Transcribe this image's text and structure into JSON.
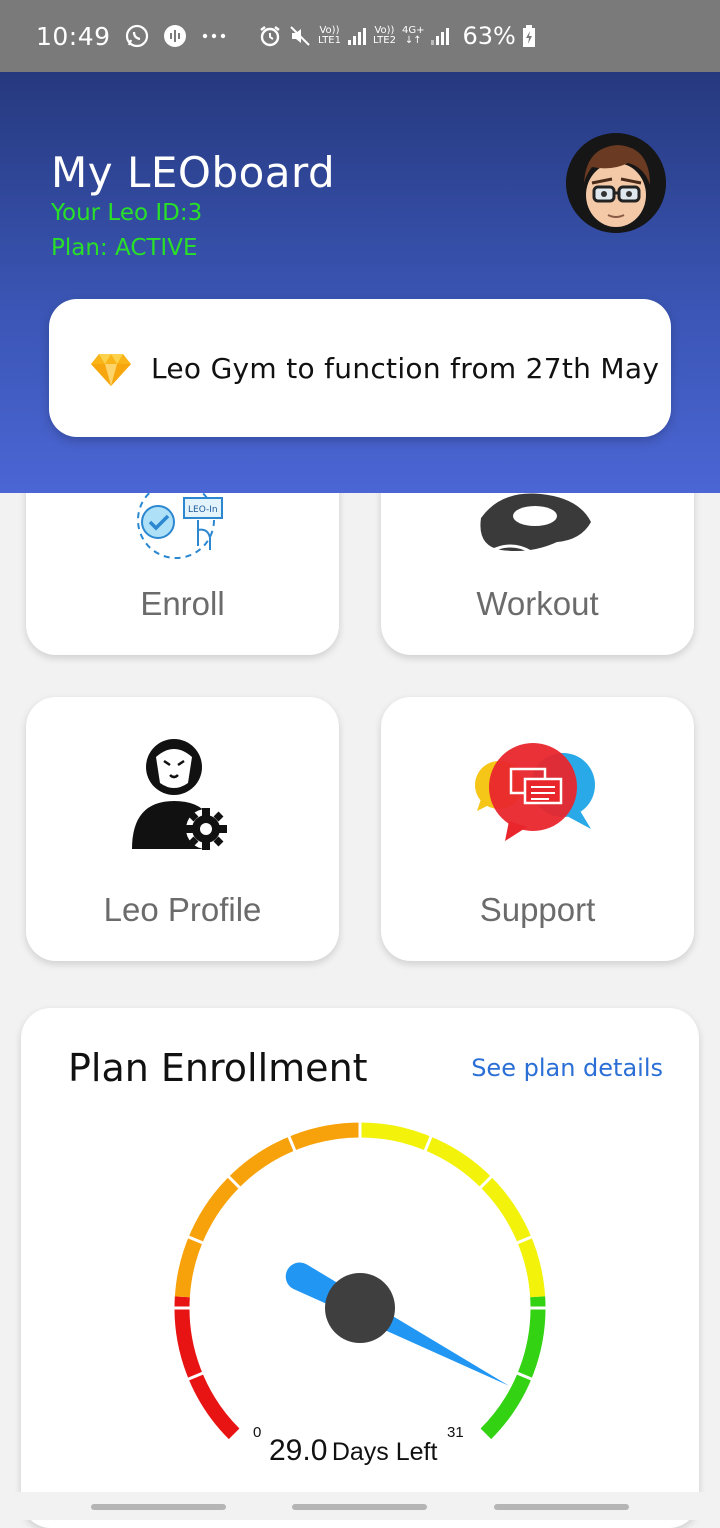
{
  "status_bar": {
    "time": "10:49",
    "icons_left": [
      "whatsapp-icon",
      "voice-icon",
      "more-icon"
    ],
    "sim1_label_top": "Vo))",
    "sim1_label_bottom": "LTE1",
    "sim2_label_top": "Vo))",
    "sim2_label_bottom": "LTE2",
    "network_type": "4G+",
    "battery_percent": "63%"
  },
  "header": {
    "title": "My LEOboard",
    "leo_id": "Your Leo ID:3",
    "plan_status": "Plan: ACTIVE",
    "notice": "Leo Gym to function from 27th May"
  },
  "tiles": [
    {
      "label": "Enroll",
      "icon": "enroll-icon"
    },
    {
      "label": "Workout",
      "icon": "workout-icon"
    },
    {
      "label": "Leo Profile",
      "icon": "leo-profile-icon"
    },
    {
      "label": "Support",
      "icon": "support-chat-icon"
    }
  ],
  "plan": {
    "title": "Plan Enrollment",
    "link": "See plan details",
    "days_value": "29.0",
    "days_label": "Days Left",
    "gauge_min": "0",
    "gauge_max": "31",
    "days_left": 29.0,
    "total_days": 31
  },
  "colors": {
    "header_top": "#26397e",
    "header_bottom": "#4b66d4",
    "status_green": "#28e028",
    "link_blue": "#2b6fd6",
    "needle": "#2196f3"
  }
}
